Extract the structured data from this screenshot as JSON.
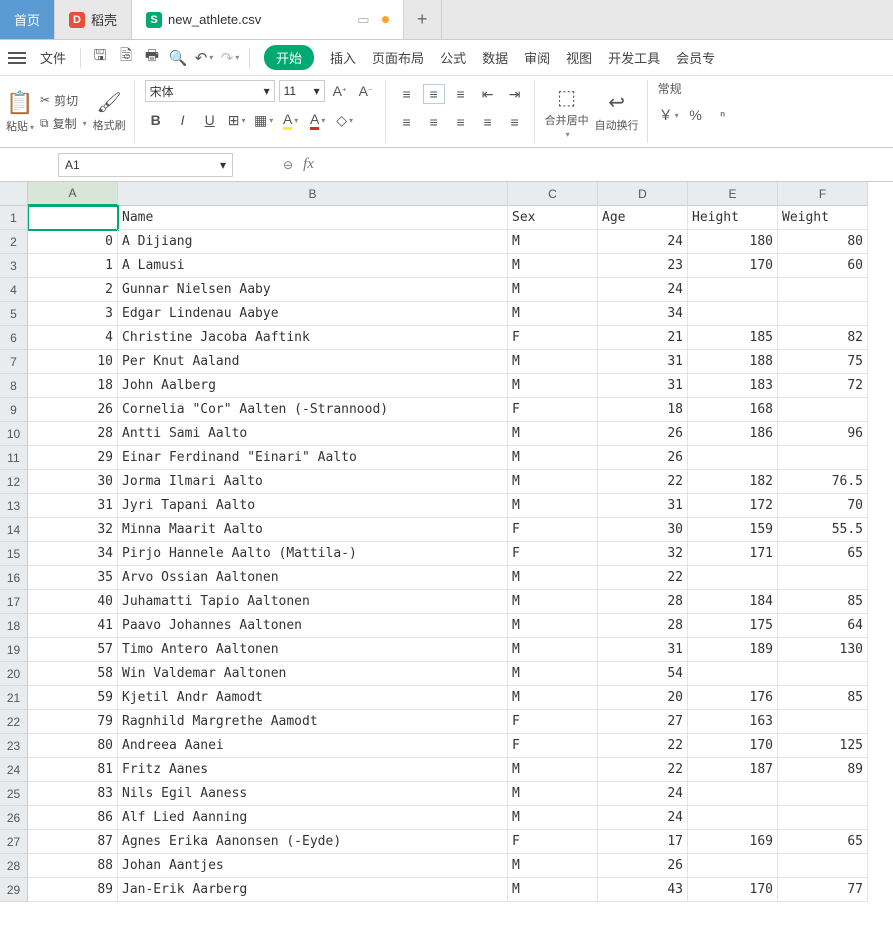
{
  "tabs": {
    "home": "首页",
    "dao": "稻壳",
    "file": "new_athlete.csv",
    "new": "+"
  },
  "menu": {
    "file": "文件",
    "start": "开始",
    "insert": "插入",
    "layout": "页面布局",
    "formula": "公式",
    "data": "数据",
    "review": "审阅",
    "view": "视图",
    "dev": "开发工具",
    "member": "会员专"
  },
  "ribbon": {
    "paste": "粘贴",
    "cut": "剪切",
    "copy": "复制",
    "format_painter": "格式刷",
    "font_name": "宋体",
    "font_size": "11",
    "merge": "合并居中",
    "wrap": "自动换行",
    "numfmt": "常规",
    "currency": "￥",
    "percent": "%"
  },
  "namebox": "A1",
  "columns": [
    "A",
    "B",
    "C",
    "D",
    "E",
    "F"
  ],
  "header_row": [
    "",
    "Name",
    "Sex",
    "Age",
    "Height",
    "Weight"
  ],
  "chart_data": {
    "type": "table",
    "columns": [
      "",
      "Name",
      "Sex",
      "Age",
      "Height",
      "Weight"
    ],
    "rows": [
      [
        0,
        "A Dijiang",
        "M",
        24,
        180,
        80
      ],
      [
        1,
        "A Lamusi",
        "M",
        23,
        170,
        60
      ],
      [
        2,
        "Gunnar Nielsen Aaby",
        "M",
        24,
        "",
        ""
      ],
      [
        3,
        "Edgar Lindenau Aabye",
        "M",
        34,
        "",
        ""
      ],
      [
        4,
        "Christine Jacoba Aaftink",
        "F",
        21,
        185,
        82
      ],
      [
        10,
        "Per Knut Aaland",
        "M",
        31,
        188,
        75
      ],
      [
        18,
        "John Aalberg",
        "M",
        31,
        183,
        72
      ],
      [
        26,
        "Cornelia \"Cor\" Aalten (-Strannood)",
        "F",
        18,
        168,
        ""
      ],
      [
        28,
        "Antti Sami Aalto",
        "M",
        26,
        186,
        96
      ],
      [
        29,
        "Einar Ferdinand \"Einari\" Aalto",
        "M",
        26,
        "",
        ""
      ],
      [
        30,
        "Jorma Ilmari Aalto",
        "M",
        22,
        182,
        76.5
      ],
      [
        31,
        "Jyri Tapani Aalto",
        "M",
        31,
        172,
        70
      ],
      [
        32,
        "Minna Maarit Aalto",
        "F",
        30,
        159,
        55.5
      ],
      [
        34,
        "Pirjo Hannele Aalto (Mattila-)",
        "F",
        32,
        171,
        65
      ],
      [
        35,
        "Arvo Ossian Aaltonen",
        "M",
        22,
        "",
        ""
      ],
      [
        40,
        "Juhamatti Tapio Aaltonen",
        "M",
        28,
        184,
        85
      ],
      [
        41,
        "Paavo Johannes Aaltonen",
        "M",
        28,
        175,
        64
      ],
      [
        57,
        "Timo Antero Aaltonen",
        "M",
        31,
        189,
        130
      ],
      [
        58,
        "Win Valdemar Aaltonen",
        "M",
        54,
        "",
        ""
      ],
      [
        59,
        "Kjetil Andr Aamodt",
        "M",
        20,
        176,
        85
      ],
      [
        79,
        "Ragnhild Margrethe Aamodt",
        "F",
        27,
        163,
        ""
      ],
      [
        80,
        "Andreea Aanei",
        "F",
        22,
        170,
        125
      ],
      [
        81,
        "Fritz Aanes",
        "M",
        22,
        187,
        89
      ],
      [
        83,
        "Nils Egil Aaness",
        "M",
        24,
        "",
        ""
      ],
      [
        86,
        "Alf Lied Aanning",
        "M",
        24,
        "",
        ""
      ],
      [
        87,
        "Agnes Erika Aanonsen (-Eyde)",
        "F",
        17,
        169,
        65
      ],
      [
        88,
        "Johan Aantjes",
        "M",
        26,
        "",
        ""
      ],
      [
        89,
        "Jan-Erik Aarberg",
        "M",
        43,
        170,
        77
      ]
    ]
  }
}
